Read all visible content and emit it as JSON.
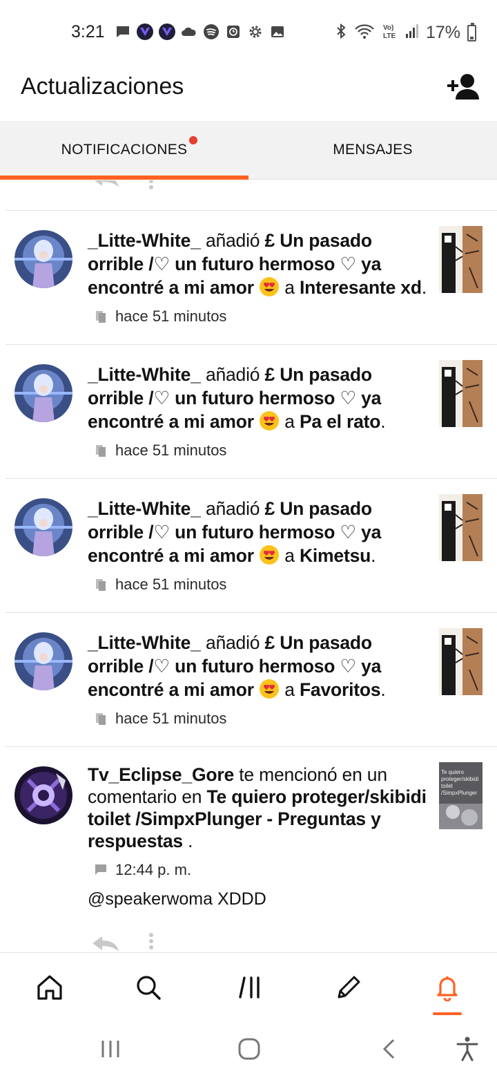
{
  "status_bar": {
    "time": "3:21",
    "battery_text": "17%",
    "left_icons": [
      "message-icon",
      "app-v-icon",
      "app-v-icon",
      "cloud-icon",
      "spotify-icon",
      "clock-app-icon",
      "settings-gear-icon",
      "gallery-icon"
    ],
    "right_icons": [
      "bluetooth-icon",
      "wifi-icon",
      "volte-icon",
      "signal-icon",
      "battery-icon"
    ]
  },
  "header": {
    "title": "Actualizaciones",
    "add_user_icon": "add-user-icon"
  },
  "tabs": [
    {
      "label": "NOTIFICACIONES",
      "active": true,
      "has_badge": true
    },
    {
      "label": "MENSAJES",
      "active": false,
      "has_badge": false
    }
  ],
  "colors": {
    "accent": "#ff6122",
    "badge": "#e53e2e",
    "tab_bg": "#f2f2f2",
    "divider": "#e2e2e2"
  },
  "notifications": [
    {
      "user": "_Litte-White_",
      "action": "añadió",
      "story": "£ Un pasado orrible /♡ un futuro hermoso ♡ ya encontré a mi amor",
      "connector": "a",
      "target": "Interesante xd",
      "time": "hace 51 minutos",
      "meta_icon": "library-add-icon"
    },
    {
      "user": "_Litte-White_",
      "action": "añadió",
      "story": "£ Un pasado orrible /♡ un futuro hermoso ♡ ya encontré a mi amor",
      "connector": "a",
      "target": "Pa el rato",
      "time": "hace 51 minutos",
      "meta_icon": "library-add-icon"
    },
    {
      "user": "_Litte-White_",
      "action": "añadió",
      "story": "£ Un pasado orrible /♡ un futuro hermoso ♡ ya encontré a mi amor",
      "connector": "a",
      "target": "Kimetsu",
      "time": "hace 51 minutos",
      "meta_icon": "library-add-icon"
    },
    {
      "user": "_Litte-White_",
      "action": "añadió",
      "story": "£ Un pasado orrible /♡ un futuro hermoso ♡ ya encontré a mi amor",
      "connector": "a",
      "target": "Favoritos",
      "time": "hace 51 minutos",
      "meta_icon": "library-add-icon"
    }
  ],
  "mention": {
    "user": "Tv_Eclipse_Gore",
    "action": "te mencionó en un comentario en",
    "story": "Te quiero proteger/skibidi toilet /SimpxPlunger - Preguntas y respuestas",
    "time": "12:44 p. m.",
    "comment": "@speakerwoma XDDD",
    "meta_icon": "comment-icon",
    "thumb_text": "Te quiero proteger/skibidi toilet /SimpxPlunger"
  },
  "bottom_nav": [
    {
      "name": "home",
      "icon": "home-icon"
    },
    {
      "name": "search",
      "icon": "search-icon"
    },
    {
      "name": "library",
      "icon": "library-icon"
    },
    {
      "name": "write",
      "icon": "pencil-icon"
    },
    {
      "name": "notifications",
      "icon": "bell-icon",
      "active": true
    }
  ],
  "system_nav": [
    "recent-apps-icon",
    "home-circle-icon",
    "back-icon",
    "accessibility-icon"
  ]
}
